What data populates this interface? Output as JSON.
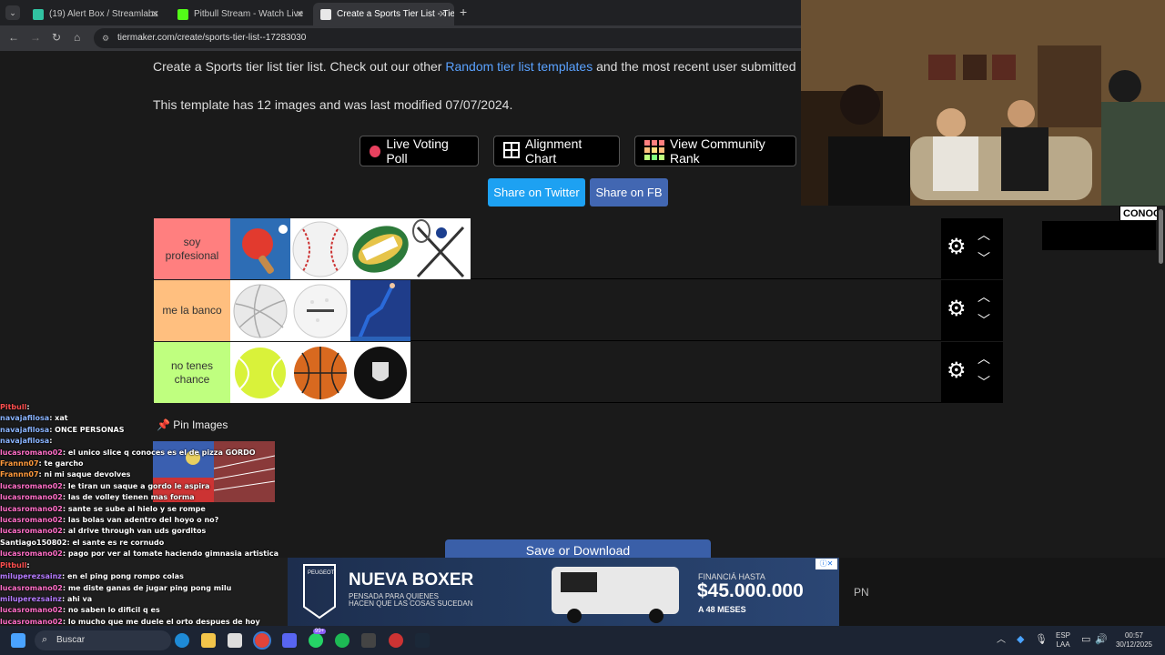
{
  "browser": {
    "tabs": [
      {
        "title": "(19) Alert Box / Streamlabs",
        "color": "#31c3a2"
      },
      {
        "title": "Pitbull Stream - Watch Live",
        "color": "#53fc18"
      },
      {
        "title": "Create a Sports Tier List - TierM",
        "color": "#e8e8e8"
      }
    ],
    "tab_menu": "⌄",
    "new_tab": "+",
    "url": "tiermaker.com/create/sports-tier-list--17283030"
  },
  "page": {
    "intro_prefix": "Create a Sports tier list tier list. Check out our other ",
    "intro_link": "Random tier list templates",
    "intro_suffix": " and the most recent user submitted",
    "meta": "This template has 12 images and was last modified 07/07/2024.",
    "buttons": {
      "live_voting": "Live Voting Poll",
      "alignment": "Alignment Chart",
      "community": "View Community Rank",
      "share_twitter": "Share on Twitter",
      "share_fb": "Share on FB"
    },
    "tiers": [
      {
        "label": "soy profesional",
        "color": "#ff7f7f",
        "items": [
          "ping-pong-paddle",
          "baseball",
          "rugby-ball",
          "lacrosse-sticks"
        ]
      },
      {
        "label": "me la banco",
        "color": "#ffbf7f",
        "items": [
          "volleyball",
          "golf-ball",
          "gymnast"
        ]
      },
      {
        "label": "no tenes chance",
        "color": "#bfff7f",
        "items": [
          "tennis-ball",
          "basketball",
          "hockey-puck"
        ]
      }
    ],
    "pin_images": "Pin Images",
    "save": "Save or Download"
  },
  "overlay": {
    "conoc": "CONOC",
    "chat": [
      {
        "user": "Pitbull",
        "msg": "",
        "color": "#ff5050"
      },
      {
        "user": "navajafilosa",
        "msg": "xat",
        "color": "#8ab4ff"
      },
      {
        "user": "navajafilosa",
        "msg": "ONCE PERSONAS",
        "color": "#8ab4ff"
      },
      {
        "user": "navajafilosa",
        "msg": "",
        "color": "#8ab4ff"
      },
      {
        "user": "lucasromano02",
        "msg": "el unico slice q conoces es el de pizza GORDO",
        "color": "#ff6ec7"
      },
      {
        "user": "Frannn07",
        "msg": "te garcho",
        "color": "#ff9a3c"
      },
      {
        "user": "Frannn07",
        "msg": "ni mi saque devolves",
        "color": "#ff9a3c"
      },
      {
        "user": "lucasromano02",
        "msg": "le tiran un saque a gordo le aspira",
        "color": "#ff6ec7"
      },
      {
        "user": "lucasromano02",
        "msg": "las de volley tienen mas forma",
        "color": "#ff6ec7"
      },
      {
        "user": "lucasromano02",
        "msg": "sante se sube al hielo y se rompe",
        "color": "#ff6ec7"
      },
      {
        "user": "lucasromano02",
        "msg": "las bolas van adentro del hoyo o no?",
        "color": "#ff6ec7"
      },
      {
        "user": "lucasromano02",
        "msg": "al drive through van uds gorditos",
        "color": "#ff6ec7"
      },
      {
        "user": "Santiago150802",
        "msg": "el sante es re cornudo",
        "color": "#ffffff"
      },
      {
        "user": "lucasromano02",
        "msg": "pago por ver al tomate haciendo gimnasia artistica",
        "color": "#ff6ec7"
      },
      {
        "user": "Pitbull",
        "msg": "",
        "color": "#ff5050"
      },
      {
        "user": "miluperezsainz",
        "msg": "en el ping pong rompo colas",
        "color": "#b57bff"
      },
      {
        "user": "lucasromano02",
        "msg": "me diste ganas de jugar ping pong milu",
        "color": "#ff6ec7"
      },
      {
        "user": "miluperezsainz",
        "msg": "ahi va",
        "color": "#b57bff"
      },
      {
        "user": "lucasromano02",
        "msg": "no saben lo dificil q es",
        "color": "#ff6ec7"
      },
      {
        "user": "lucasromano02",
        "msg": "lo mucho que me duele el orto despues de hoy",
        "color": "#ff6ec7"
      }
    ],
    "ad": {
      "brand": "PEUGEOT",
      "headline": "NUEVA BOXER",
      "sub1": "PENSADA PARA QUIENES",
      "sub2": "HACEN QUE LAS COSAS SUCEDAN",
      "fin_label": "FINANCIÁ HASTA",
      "amount": "$45.000.000",
      "months": "A 48 MESES"
    },
    "pn": "PN"
  },
  "taskbar": {
    "search": "Buscar",
    "lang1": "ESP",
    "lang2": "LAA",
    "time": "00:57",
    "date": "30/12/2025",
    "badge": "99+"
  }
}
